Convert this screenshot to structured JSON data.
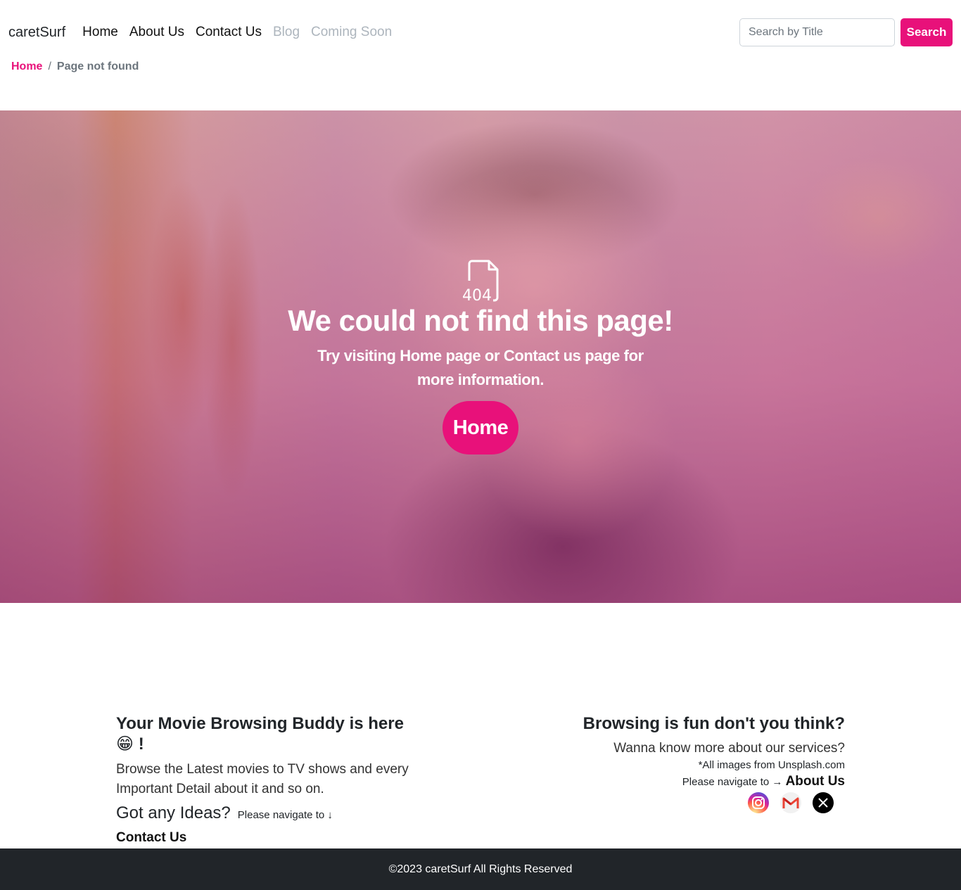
{
  "navbar": {
    "brand": "caretSurf",
    "links": [
      {
        "label": "Home",
        "disabled": false
      },
      {
        "label": "About Us",
        "disabled": false
      },
      {
        "label": "Contact Us",
        "disabled": false
      },
      {
        "label": "Blog",
        "disabled": true
      },
      {
        "label": "Coming Soon",
        "disabled": true
      }
    ],
    "search": {
      "placeholder": "Search by Title",
      "value": "",
      "button_label": "Search"
    }
  },
  "breadcrumb": {
    "home": "Home",
    "separator": "/",
    "current": "Page not found"
  },
  "hero": {
    "icon": "file-404-icon",
    "icon_text": "404",
    "title": "We could not find this page!",
    "subtitle": "Try visiting Home page or Contact us page for more information.",
    "button_label": "Home"
  },
  "footer": {
    "left": {
      "heading": "Your Movie Browsing Buddy is here 😁 !",
      "text": "Browse the Latest movies to TV shows and every Important Detail about it and so on.",
      "ideas_heading": "Got any Ideas?",
      "nav_note": "Please navigate to ↓",
      "contact_link": "Contact Us"
    },
    "right": {
      "heading": "Browsing is fun don't you think?",
      "text": "Wanna know more about our services?",
      "credit": "*All images from Unsplash.com",
      "nav_note": "Please navigate to →",
      "about_link": "About Us",
      "socials": [
        "instagram-icon",
        "gmail-icon",
        "x-icon"
      ]
    }
  },
  "copyright": "©2023 caretSurf All Rights Reserved",
  "colors": {
    "accent": "#e8117a",
    "dark": "#212529"
  }
}
